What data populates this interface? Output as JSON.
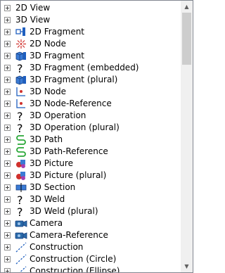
{
  "tree": {
    "items": [
      {
        "label": "2D View",
        "icon": "none"
      },
      {
        "label": "3D View",
        "icon": "none"
      },
      {
        "label": "2D Fragment",
        "icon": "fragment-2d-icon"
      },
      {
        "label": "2D Node",
        "icon": "node-2d-icon"
      },
      {
        "label": "3D Fragment",
        "icon": "fragment-3d-icon"
      },
      {
        "label": "3D Fragment (embedded)",
        "icon": "question-icon"
      },
      {
        "label": "3D Fragment (plural)",
        "icon": "fragment-3d-icon"
      },
      {
        "label": "3D Node",
        "icon": "node-3d-icon"
      },
      {
        "label": "3D Node-Reference",
        "icon": "node-3d-icon"
      },
      {
        "label": "3D Operation",
        "icon": "question-icon"
      },
      {
        "label": "3D Operation (plural)",
        "icon": "question-icon"
      },
      {
        "label": "3D Path",
        "icon": "path-icon"
      },
      {
        "label": "3D Path-Reference",
        "icon": "path-icon"
      },
      {
        "label": "3D Picture",
        "icon": "picture-icon"
      },
      {
        "label": "3D Picture (plural)",
        "icon": "picture-icon"
      },
      {
        "label": "3D Section",
        "icon": "section-icon"
      },
      {
        "label": "3D Weld",
        "icon": "question-icon"
      },
      {
        "label": "3D Weld (plural)",
        "icon": "question-icon"
      },
      {
        "label": "Camera",
        "icon": "camera-icon"
      },
      {
        "label": "Camera-Reference",
        "icon": "camera-icon"
      },
      {
        "label": "Construction",
        "icon": "construction-line-icon"
      },
      {
        "label": "Construction (Circle)",
        "icon": "construction-line-icon"
      },
      {
        "label": "Construction (Ellipse)",
        "icon": "construction-line-icon"
      }
    ]
  },
  "colors": {
    "border": "#828790",
    "scrollbar_track": "#f0f0f0",
    "scrollbar_thumb": "#cdcdcd",
    "accent_blue": "#1f5fbf",
    "accent_green": "#2aa838",
    "accent_red": "#d0312d"
  }
}
